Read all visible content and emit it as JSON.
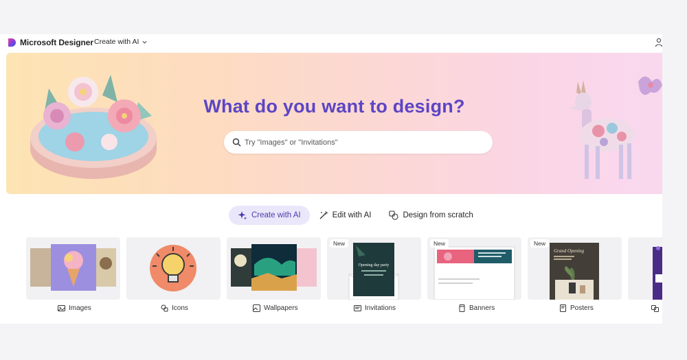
{
  "app": {
    "brand": "Microsoft Designer",
    "create_menu_label": "Create with AI",
    "colors": {
      "accent": "#5b45c5",
      "active_tab_bg": "#ebe7fb"
    }
  },
  "hero": {
    "title": "What do you want to design?",
    "search_placeholder": "Try \"Images\" or \"Invitations\"",
    "search_value": ""
  },
  "modes": [
    {
      "label": "Create with AI",
      "icon": "sparkle-icon",
      "active": true
    },
    {
      "label": "Edit with AI",
      "icon": "magic-wand-icon",
      "active": false
    },
    {
      "label": "Design from scratch",
      "icon": "shapes-icon",
      "active": false
    }
  ],
  "categories": [
    {
      "label": "Images",
      "icon": "image-icon",
      "badge": ""
    },
    {
      "label": "Icons",
      "icon": "icon-set-icon",
      "badge": ""
    },
    {
      "label": "Wallpapers",
      "icon": "wallpaper-icon",
      "badge": ""
    },
    {
      "label": "Invitations",
      "icon": "invitation-icon",
      "badge": "New",
      "card_text": "Opening day party"
    },
    {
      "label": "Banners",
      "icon": "banner-icon",
      "badge": "New"
    },
    {
      "label": "Posters",
      "icon": "poster-icon",
      "badge": "New",
      "card_text": "Grand Opening"
    },
    {
      "label": "",
      "icon": "more-icon",
      "badge": ""
    }
  ]
}
